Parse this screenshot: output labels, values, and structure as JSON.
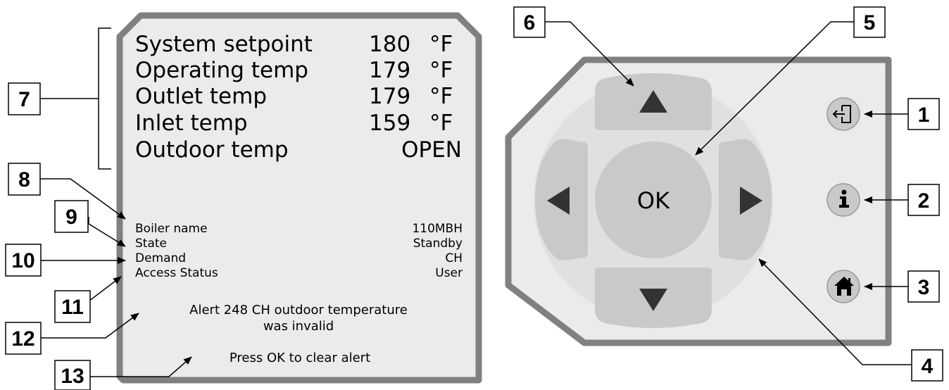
{
  "screen": {
    "readings": [
      {
        "label": "System setpoint",
        "value": "180",
        "unit": "°F"
      },
      {
        "label": "Operating temp",
        "value": "179",
        "unit": "°F"
      },
      {
        "label": "Outlet temp",
        "value": "179",
        "unit": "°F"
      },
      {
        "label": "Inlet temp",
        "value": "159",
        "unit": "°F"
      },
      {
        "label": "Outdoor temp",
        "value": "OPEN",
        "unit": ""
      }
    ],
    "status": [
      {
        "label": "Boiler name",
        "value": "110MBH"
      },
      {
        "label": "State",
        "value": "Standby"
      },
      {
        "label": "Demand",
        "value": "CH"
      },
      {
        "label": "Access Status",
        "value": "User"
      }
    ],
    "alert_line1": "Alert 248 CH outdoor temperature",
    "alert_line2": "was invalid",
    "prompt": "Press OK to clear alert"
  },
  "keypad": {
    "ok_label": "OK",
    "icons": {
      "up": "up-arrow-icon",
      "down": "down-arrow-icon",
      "left": "left-arrow-icon",
      "right": "right-arrow-icon",
      "exit": "exit-icon",
      "info": "info-icon",
      "home": "home-icon"
    }
  },
  "callouts": {
    "c1": "1",
    "c2": "2",
    "c3": "3",
    "c4": "4",
    "c5": "5",
    "c6": "6",
    "c7": "7",
    "c8": "8",
    "c9": "9",
    "c10": "10",
    "c11": "11",
    "c12": "12",
    "c13": "13"
  },
  "colors": {
    "bezel": "#808080",
    "panel": "#ebebeb",
    "key": "#c9c9c9",
    "ring": "#dcdcdc"
  }
}
